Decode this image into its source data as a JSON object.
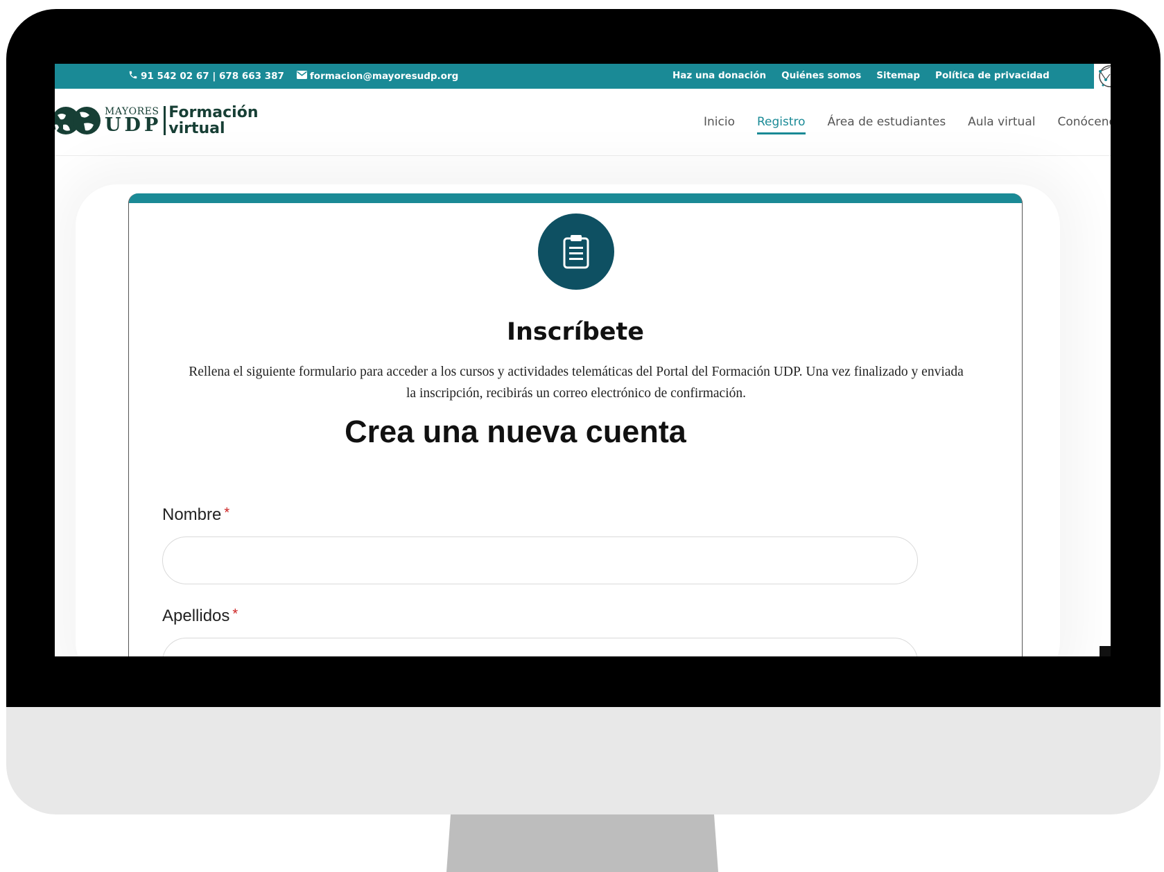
{
  "topbar": {
    "phone": "91 542 02 67 | 678 663 387",
    "email": "formacion@mayoresudp.org",
    "links": [
      "Haz una donación",
      "Quiénes somos",
      "Sitemap",
      "Política de privacidad"
    ],
    "color": "#1a8a96"
  },
  "logo": {
    "small": "MAYORES",
    "big": "UDP",
    "line1": "Formación",
    "line2": "virtual"
  },
  "nav": {
    "items": [
      "Inicio",
      "Registro",
      "Área de estudiantes",
      "Aula virtual",
      "Conócenos"
    ],
    "active": "Registro"
  },
  "card": {
    "icon": "clipboard-icon",
    "title": "Inscríbete",
    "description": "Rellena el siguiente formulario para acceder a los cursos y actividades telemáticas del Portal del Formación UDP.  Una vez finalizado y enviada la inscripción, recibirás un correo electrónico de confirmación.",
    "subtitle": "Crea una nueva cuenta"
  },
  "form": {
    "fields": [
      {
        "label": "Nombre",
        "required": "*",
        "value": ""
      },
      {
        "label": "Apellidos",
        "required": "*",
        "value": ""
      }
    ]
  },
  "colors": {
    "accent": "#1a8a96",
    "icon_bg": "#0e5062",
    "logo": "#173f35",
    "required": "#cc2222"
  }
}
